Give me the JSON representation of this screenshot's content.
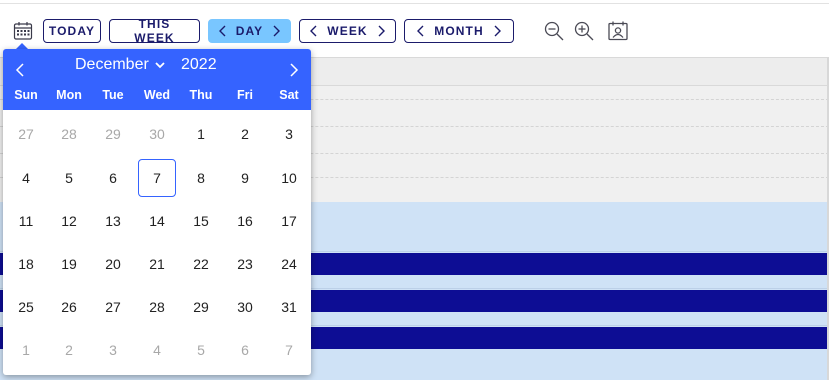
{
  "toolbar": {
    "calendar_icon": "calendar-icon",
    "buttons": {
      "today": "TODAY",
      "this_week": "THIS WEEK",
      "day": "DAY",
      "week": "WEEK",
      "month": "MONTH"
    },
    "active_view": "DAY",
    "icons": [
      "zoom-out-icon",
      "zoom-in-icon",
      "user-card-icon"
    ]
  },
  "datepicker": {
    "month": "December",
    "year": "2022",
    "weekdays": [
      "Sun",
      "Mon",
      "Tue",
      "Wed",
      "Thu",
      "Fri",
      "Sat"
    ],
    "weeks": [
      [
        "27",
        "28",
        "29",
        "30",
        "1",
        "2",
        "3"
      ],
      [
        "4",
        "5",
        "6",
        "7",
        "8",
        "9",
        "10"
      ],
      [
        "11",
        "12",
        "13",
        "14",
        "15",
        "16",
        "17"
      ],
      [
        "18",
        "19",
        "20",
        "21",
        "22",
        "23",
        "24"
      ],
      [
        "25",
        "26",
        "27",
        "28",
        "29",
        "30",
        "31"
      ],
      [
        "1",
        "2",
        "3",
        "4",
        "5",
        "6",
        "7"
      ]
    ],
    "selected_day": "7",
    "colors": {
      "header": "#3563ff",
      "selected_border": "#3563ff",
      "muted_text": "#a8a8a8"
    }
  },
  "schedule": {
    "colors": {
      "event": "#0d0d94",
      "slot_background": "#cfe2f6",
      "all_day_background": "#f0f0f0",
      "active_view_button": "#79c6ff"
    },
    "event_count": 3
  }
}
